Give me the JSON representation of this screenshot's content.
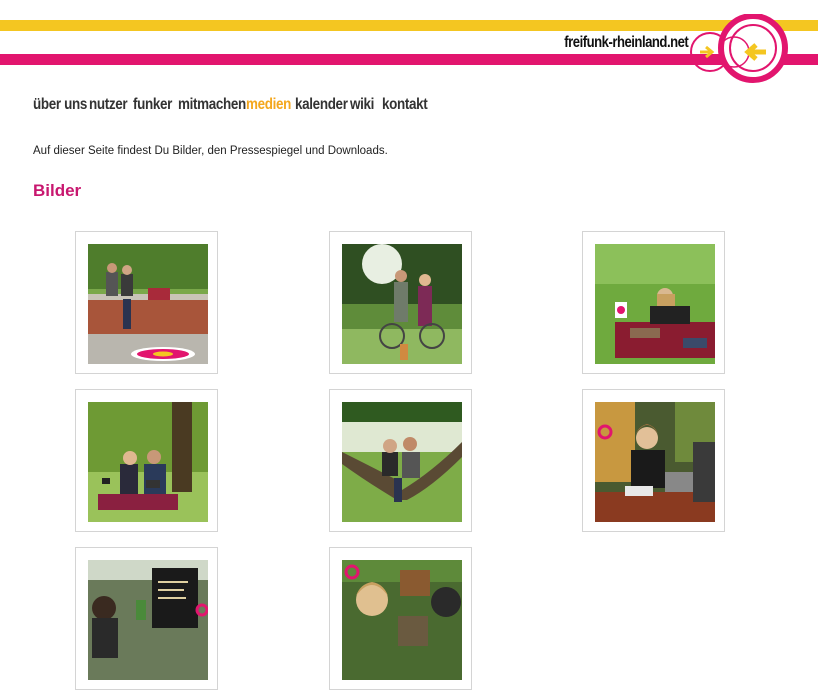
{
  "header": {
    "site_title": "freifunk-rheinland.net",
    "colors": {
      "yellow": "#f4c621",
      "pink": "#e2156e"
    }
  },
  "nav": {
    "items": [
      {
        "label": "über uns",
        "active": false
      },
      {
        "label": "nutzer",
        "active": false
      },
      {
        "label": "funker",
        "active": false
      },
      {
        "label": "mitmachen",
        "active": false
      },
      {
        "label": "medien",
        "active": true
      },
      {
        "label": "kalender",
        "active": false
      },
      {
        "label": "wiki",
        "active": false
      },
      {
        "label": "kontakt",
        "active": false
      }
    ],
    "active_color": "#f4a71d"
  },
  "main": {
    "intro": "Auf dieser Seite findest Du Bilder, den Pressespiegel und Downloads.",
    "section_title": "Bilder",
    "section_color": "#c8176f"
  }
}
